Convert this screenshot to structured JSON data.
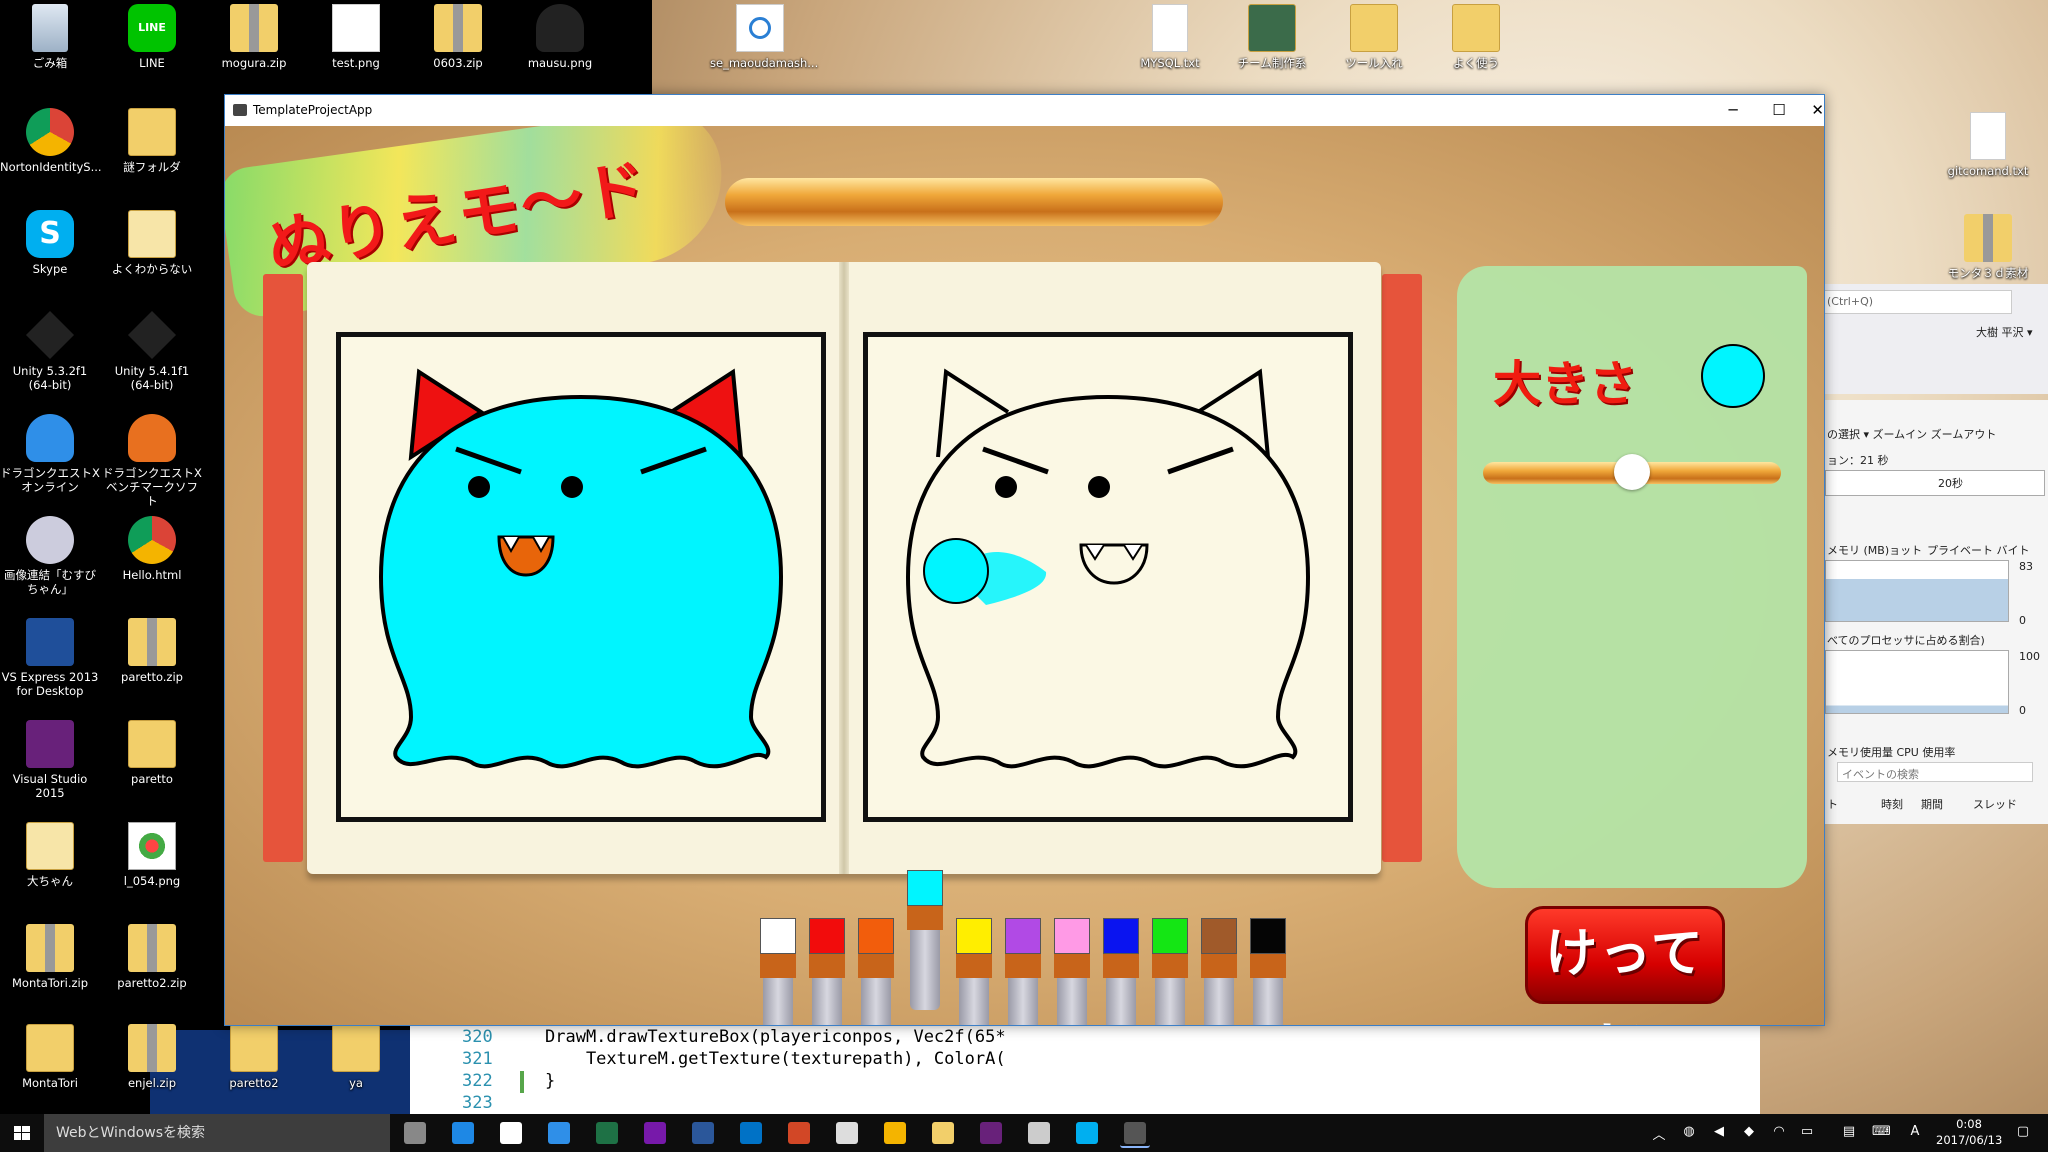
{
  "desktop": {
    "top_icons": [
      {
        "label": "ごみ箱",
        "icon": "recycle-bin-icon"
      },
      {
        "label": "LINE",
        "icon": "line-app-icon"
      },
      {
        "label": "mogura.zip",
        "icon": "zip-folder-icon"
      },
      {
        "label": "test.png",
        "icon": "image-file-icon"
      },
      {
        "label": "0603.zip",
        "icon": "zip-folder-icon"
      },
      {
        "label": "mausu.png",
        "icon": "image-file-icon"
      },
      {
        "label": "se_maoudamash...",
        "icon": "audio-file-icon"
      },
      {
        "label": "MYSQL.txt",
        "icon": "text-file-icon"
      },
      {
        "label": "チーム制作系",
        "icon": "folder-icon"
      },
      {
        "label": "ツール入れ",
        "icon": "folder-icon"
      },
      {
        "label": "よく使う",
        "icon": "folder-icon"
      }
    ],
    "left_icons": [
      {
        "label": "NortonIdentityS...",
        "icon": "chrome-icon"
      },
      {
        "label": "謎フォルダ",
        "icon": "folder-icon"
      },
      {
        "label": "Skype",
        "icon": "skype-icon"
      },
      {
        "label": "よくわからない",
        "icon": "folder-icon"
      },
      {
        "label": "Unity 5.3.2f1 (64-bit)",
        "icon": "unity-icon"
      },
      {
        "label": "Unity 5.4.1f1 (64-bit)",
        "icon": "unity-icon"
      },
      {
        "label": "ドラゴンクエストX オンライン",
        "icon": "slime-icon"
      },
      {
        "label": "ドラゴンクエストX ベンチマークソフト",
        "icon": "slime-icon"
      },
      {
        "label": "画像連結「むすびちゃん」",
        "icon": "app-icon"
      },
      {
        "label": "Hello.html",
        "icon": "chrome-icon"
      },
      {
        "label": "VS Express 2013 for Desktop",
        "icon": "visual-studio-icon"
      },
      {
        "label": "paretto.zip",
        "icon": "zip-folder-icon"
      },
      {
        "label": "Visual Studio 2015",
        "icon": "visual-studio-icon"
      },
      {
        "label": "paretto",
        "icon": "folder-icon"
      },
      {
        "label": "大ちゃん",
        "icon": "folder-icon"
      },
      {
        "label": "l_054.png",
        "icon": "image-file-icon"
      },
      {
        "label": "MontaTori.zip",
        "icon": "zip-folder-icon"
      },
      {
        "label": "paretto2.zip",
        "icon": "zip-folder-icon"
      },
      {
        "label": "MontaTori",
        "icon": "folder-icon"
      },
      {
        "label": "enjel.zip",
        "icon": "zip-folder-icon"
      },
      {
        "label": "paretto2",
        "icon": "folder-icon"
      },
      {
        "label": "ya",
        "icon": "folder-icon"
      }
    ],
    "right_icons": [
      {
        "label": "gitcomand.txt",
        "icon": "text-file-icon"
      },
      {
        "label": "モンタ３ｄ素材",
        "icon": "zip-folder-icon"
      }
    ]
  },
  "vs_panel": {
    "search_placeholder": "(Ctrl+Q)",
    "user": "大樹 平沢 ▾",
    "toolbar": "の選択 ▾   ズームイン   ズームアウト",
    "session": "ョン：21 秒",
    "timeline_label": "20秒",
    "memory_label": "メモリ (MB)ョット",
    "private_bytes": "プライベート バイト",
    "mem_max": "83",
    "mem_min": "0",
    "cpu_label": "べてのプロセッサに占める割合)",
    "cpu_max": "100",
    "cpu_min": "0",
    "tabs": "メモリ使用量   CPU 使用率",
    "event_search": "イベントの検索",
    "columns": [
      "ト",
      "時刻",
      "期間",
      "スレッド"
    ]
  },
  "editor": {
    "lines": [
      {
        "num": "320",
        "text": "DrawM.drawTextureBox(playericonpos, Vec2f(65*"
      },
      {
        "num": "321",
        "text": "    TextureM.getTexture(texturepath), ColorA("
      },
      {
        "num": "322",
        "text": "}"
      },
      {
        "num": "323",
        "text": ""
      }
    ]
  },
  "window": {
    "title": "TemplateProjectApp",
    "minimize": "─",
    "maximize": "☐",
    "close": "✕"
  },
  "game": {
    "mode_title": "ぬりえモ～ド",
    "size_label": "大きさ",
    "brush_size_fraction": 0.5,
    "decide_label": "けってい",
    "current_color": "#00f5ff",
    "sample_colors": {
      "body": "#00f5ff",
      "ears": "#ee1111",
      "mouth": "#e8650a"
    },
    "palette": [
      {
        "name": "white",
        "color": "#ffffff",
        "selected": false
      },
      {
        "name": "red",
        "color": "#f20c0c",
        "selected": false
      },
      {
        "name": "orange",
        "color": "#f25d0c",
        "selected": false
      },
      {
        "name": "cyan",
        "color": "#00f5ff",
        "selected": true
      },
      {
        "name": "yellow",
        "color": "#ffee00",
        "selected": false
      },
      {
        "name": "purple",
        "color": "#b14ae5",
        "selected": false
      },
      {
        "name": "pink",
        "color": "#ff9ae6",
        "selected": false
      },
      {
        "name": "blue",
        "color": "#0a14f0",
        "selected": false
      },
      {
        "name": "green",
        "color": "#14e614",
        "selected": false
      },
      {
        "name": "brown",
        "color": "#a05a2a",
        "selected": false
      },
      {
        "name": "black",
        "color": "#050505",
        "selected": false
      }
    ]
  },
  "taskbar": {
    "search_placeholder": "WebとWindowsを検索",
    "time": "0:08",
    "date": "2017/06/13",
    "ime": "A",
    "apps": [
      "task-view-icon",
      "edge-icon",
      "store-icon",
      "ie-icon",
      "excel-icon",
      "onenote-icon",
      "word-icon",
      "outlook-icon",
      "powerpoint-icon",
      "unity-icon",
      "chrome-icon",
      "explorer-icon",
      "visual-studio-icon",
      "sourcetree-icon",
      "skype-icon",
      "app-icon"
    ]
  }
}
